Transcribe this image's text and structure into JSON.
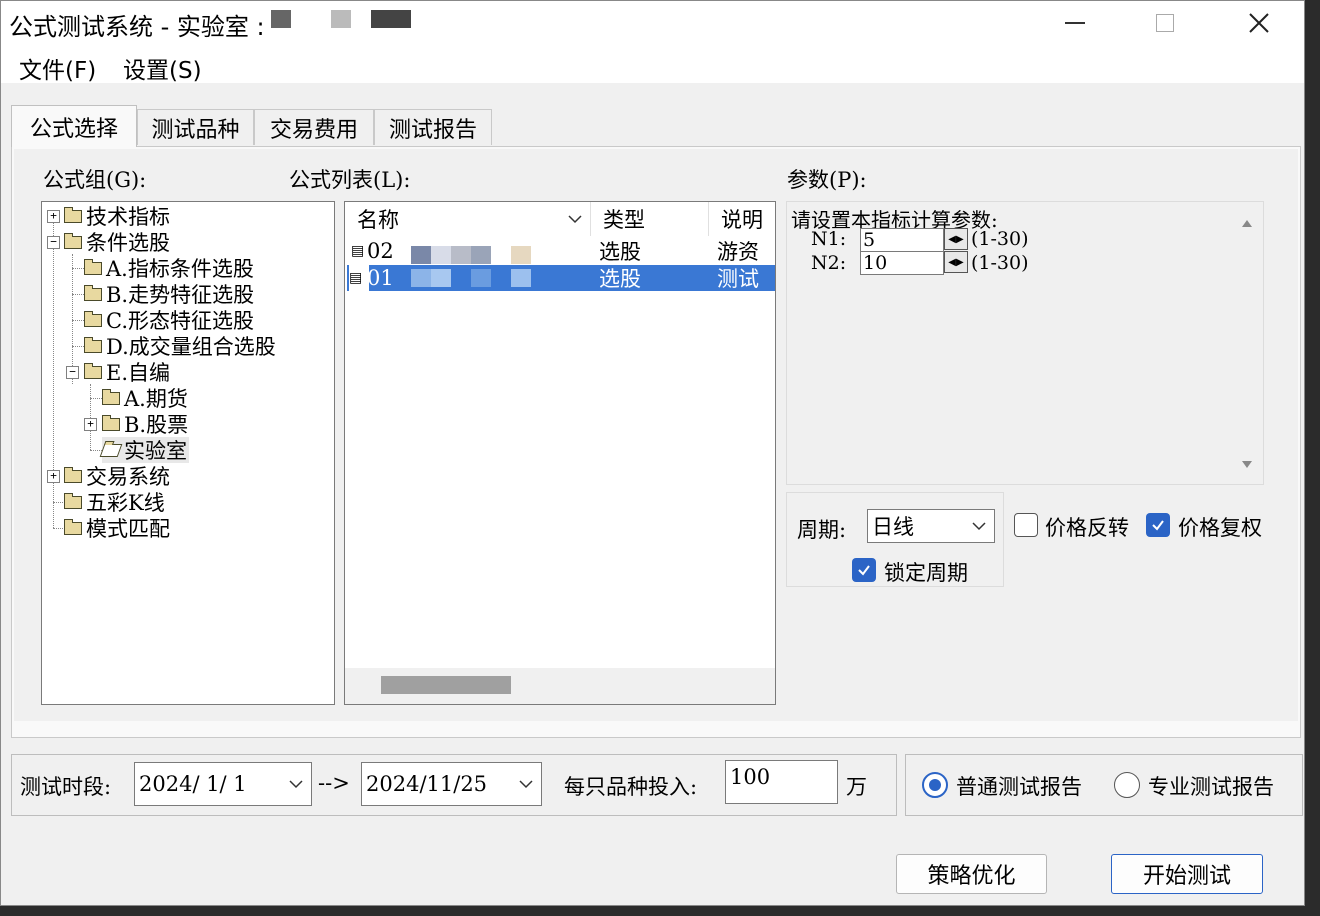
{
  "window": {
    "title": "公式测试系统 - 实验室 :",
    "title_swatch_colors": [
      "#666666",
      "#bbbbbb",
      "#444444"
    ],
    "controls": {
      "minimize": "—",
      "maximize": "☐",
      "close": "✕"
    }
  },
  "menu": {
    "file": "文件(F)",
    "settings": "设置(S)"
  },
  "tabs": [
    {
      "label": "公式选择",
      "active": true
    },
    {
      "label": "测试品种",
      "active": false
    },
    {
      "label": "交易费用",
      "active": false
    },
    {
      "label": "测试报告",
      "active": false
    }
  ],
  "formula_group": {
    "label": "公式组(G):",
    "tree": [
      {
        "label": "技术指标",
        "expander": "+"
      },
      {
        "label": "条件选股",
        "expander": "−"
      },
      {
        "label": "A.指标条件选股"
      },
      {
        "label": "B.走势特征选股"
      },
      {
        "label": "C.形态特征选股"
      },
      {
        "label": "D.成交量组合选股"
      },
      {
        "label": "E.自编",
        "expander": "−"
      },
      {
        "label": "A.期货"
      },
      {
        "label": "B.股票",
        "expander": "+"
      },
      {
        "label": "实验室",
        "selected": true
      },
      {
        "label": "交易系统",
        "expander": "+"
      },
      {
        "label": "五彩K线"
      },
      {
        "label": "模式匹配"
      }
    ]
  },
  "formula_list": {
    "label": "公式列表(L):",
    "columns": {
      "name": "名称",
      "type": "类型",
      "desc": "说明"
    },
    "rows": [
      {
        "name": "02",
        "type": "选股",
        "desc": "游资",
        "selected": false
      },
      {
        "name": "01",
        "type": "选股",
        "desc": "测试",
        "selected": true
      }
    ]
  },
  "params": {
    "label": "参数(P):",
    "prompt": "请设置本指标计算参数:",
    "items": [
      {
        "name": "N1:",
        "value": "5",
        "range": "(1-30)"
      },
      {
        "name": "N2:",
        "value": "10",
        "range": "(1-30)"
      }
    ]
  },
  "period": {
    "label": "周期:",
    "value": "日线",
    "lock_label": "锁定周期",
    "lock_checked": true
  },
  "options": {
    "reverse_label": "价格反转",
    "reverse_checked": false,
    "adjust_label": "价格复权",
    "adjust_checked": true
  },
  "test_range": {
    "label": "测试时段:",
    "start": "2024/ 1/ 1",
    "arrow": "-->",
    "end": "2024/11/25",
    "invest_label": "每只品种投入:",
    "invest_value": "100",
    "unit": "万"
  },
  "report": {
    "normal_label": "普通测试报告",
    "normal_selected": true,
    "pro_label": "专业测试报告",
    "pro_selected": false
  },
  "buttons": {
    "optimize": "策略优化",
    "start": "开始测试"
  },
  "colors": {
    "accent": "#2b64c6",
    "selection": "#3a78d4"
  }
}
